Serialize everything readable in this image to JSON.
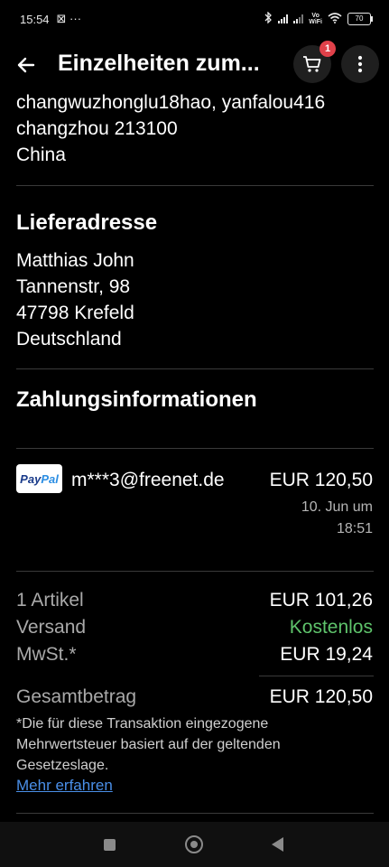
{
  "status_bar": {
    "time": "15:54",
    "left_icons": "⊠ ···",
    "vo_wifi": [
      "Vo",
      "WiFi"
    ],
    "battery": "70"
  },
  "app_bar": {
    "title": "Einzelheiten zum...",
    "cart_badge": "1"
  },
  "seller_address": {
    "lines": [
      "changwuzhonglu18hao, yanfalou416",
      "changzhou 213100",
      "China"
    ]
  },
  "delivery": {
    "heading": "Lieferadresse",
    "lines": [
      "Matthias John",
      "Tannenstr, 98",
      "47798 Krefeld",
      "Deutschland"
    ]
  },
  "payment": {
    "heading": "Zahlungsinformationen",
    "logo_text": [
      "Pay",
      "Pal"
    ],
    "email": "m***3@freenet.de",
    "amount": "EUR 120,50",
    "date_lines": [
      "10. Jun um",
      "18:51"
    ]
  },
  "summary": {
    "rows": [
      {
        "label": "1 Artikel",
        "value": "EUR 101,26"
      },
      {
        "label": "Versand",
        "value": "Kostenlos"
      },
      {
        "label": "MwSt.*",
        "value": "EUR 19,24"
      }
    ],
    "total_label": "Gesamtbetrag",
    "total_value": "EUR 120,50",
    "note": "*Die für diese Transaktion eingezogene Mehrwertsteuer basiert auf der geltenden Gesetzeslage.",
    "link": "Mehr erfahren"
  },
  "colors": {
    "free_shipping": "#5ec36b",
    "link": "#4a8fe8",
    "badge": "#e0414a"
  }
}
